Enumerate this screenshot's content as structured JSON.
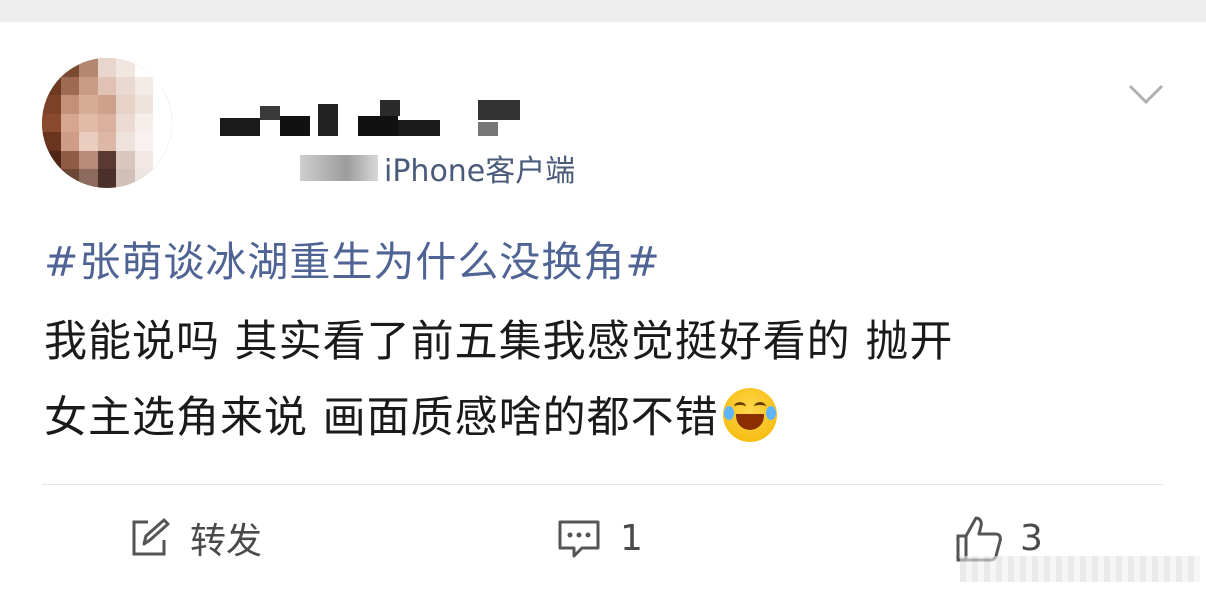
{
  "post": {
    "source_label": "iPhone客户端",
    "hashtag": "#张萌谈冰湖重生为什么没换角#",
    "content_line1": "我能说吗 其实看了前五集我感觉挺好看的 抛开",
    "content_line2": "女主选角来说 画面质感啥的都不错",
    "emoji_icon": "laughing-with-tears-emoji"
  },
  "actions": {
    "repost_label": "转发",
    "comment_count": "1",
    "like_count": "3"
  },
  "colors": {
    "hashtag": "#4f6494",
    "text": "#1a1a1a",
    "secondary": "#4a4a4a"
  }
}
